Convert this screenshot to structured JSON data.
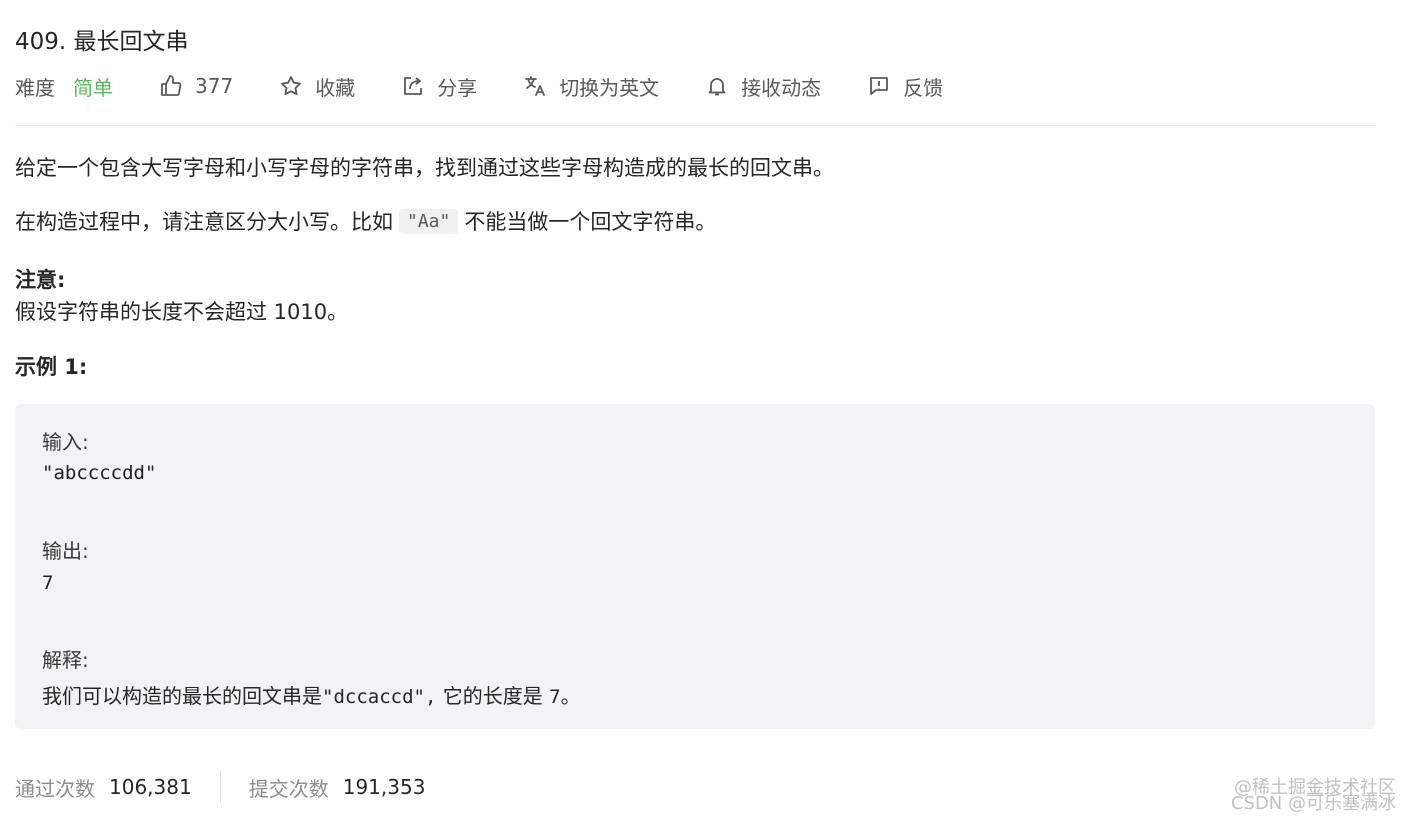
{
  "problem": {
    "title": "409. 最长回文串",
    "difficulty_label": "难度",
    "difficulty_value": "简单",
    "likes": "377",
    "favorite_label": "收藏",
    "share_label": "分享",
    "translate_label": "切换为英文",
    "notify_label": "接收动态",
    "feedback_label": "反馈"
  },
  "description": {
    "para1": "给定一个包含大写字母和小写字母的字符串，找到通过这些字母构造成的最长的回文串。",
    "para2_before": "在构造过程中，请注意区分大小写。比如",
    "para2_code": "\"Aa\"",
    "para2_after": "不能当做一个回文字符串。",
    "note_title": "注意:",
    "note_text": "假设字符串的长度不会超过 1010。",
    "example_title": "示例 1:"
  },
  "example": {
    "input_label": "输入:",
    "input_value": "\"abccccdd\"",
    "output_label": "输出:",
    "output_value": "7",
    "explain_label": "解释:",
    "explain_prefix": "我们可以构造的最长的回文串是",
    "explain_code": "\"dccaccd\",",
    "explain_suffix": " 它的长度是 ",
    "explain_num": "7",
    "explain_end": "。"
  },
  "stats": {
    "accepted_label": "通过次数",
    "accepted_value": "106,381",
    "submitted_label": "提交次数",
    "submitted_value": "191,353"
  },
  "watermark": {
    "line1": "@稀土掘金技术社区",
    "line2": "CSDN @可乐塞满冰"
  },
  "colors": {
    "difficulty_easy": "#5cb85c",
    "example_bg": "#f2f3f5"
  }
}
